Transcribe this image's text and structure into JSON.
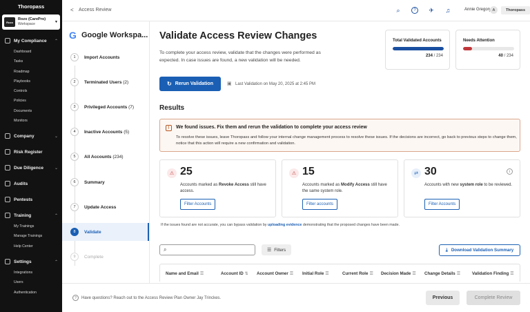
{
  "brand": "Thoropass",
  "workspace": {
    "logo": "Rozo",
    "name": "Rozo (CarePro)",
    "sub": "Workspace"
  },
  "nav": {
    "my_compliance": "My Compliance",
    "compliance_items": [
      "Dashboard",
      "Tasks",
      "Roadmap",
      "Playbooks",
      "Controls",
      "Policies",
      "Documents",
      "Monitors"
    ],
    "company": "Company",
    "risk_register": "Risk Register",
    "due_diligence": "Due Diligence",
    "audits": "Audits",
    "pentests": "Pentests",
    "training": "Training",
    "training_items": [
      "My Trainings",
      "Manage Trainings",
      "Help Center"
    ],
    "settings": "Settings",
    "settings_items": [
      "Integrations",
      "Users",
      "Authentication"
    ]
  },
  "topbar": {
    "back": "<",
    "breadcrumb": "Access Review",
    "user_name": "Annie Gregory",
    "user_initial": "A",
    "org": "Thoropass"
  },
  "steps_panel": {
    "integration": "Google Workspa...",
    "steps": [
      {
        "num": "1",
        "label": "Import Accounts",
        "count": ""
      },
      {
        "num": "2",
        "label": "Terminated Users",
        "count": "(2)"
      },
      {
        "num": "3",
        "label": "Privileged Accounts",
        "count": "(7)"
      },
      {
        "num": "4",
        "label": "Inactive Accounts",
        "count": "(5)"
      },
      {
        "num": "5",
        "label": "All Accounts",
        "count": "(234)"
      },
      {
        "num": "6",
        "label": "Summary",
        "count": ""
      },
      {
        "num": "7",
        "label": "Update Access",
        "count": ""
      },
      {
        "num": "8",
        "label": "Validate",
        "count": ""
      },
      {
        "num": "9",
        "label": "Complete",
        "count": ""
      }
    ]
  },
  "main": {
    "title": "Validate Access Review Changes",
    "intro": "To complete your access review, validate that the changes were performed as expected. In case issues are found, a new validation will be needed.",
    "stats": [
      {
        "title": "Total Validated Accounts",
        "value": "234",
        "total": "/ 234",
        "progress": 1.0,
        "color": "#1a4fa0"
      },
      {
        "title": "Needs Attention",
        "value": "40",
        "total": "/ 234",
        "progress": 0.17,
        "color": "#c0373a"
      }
    ],
    "rerun_label": "Rerun Validation",
    "last_validation": "Last Validation on May 20, 2025 at 2:45 PM",
    "results_heading": "Results",
    "alert": {
      "title": "We found issues. Fix them and rerun the validation to complete your access review",
      "body": "To resolve these issues, leave Thoropass and follow your internal change management process to resolve these issues. If the decisions are incorrect, go back to previous steps to change them, notice that this action will require a new confirmation and validation."
    },
    "cards": [
      {
        "count": "25",
        "pre": "Accounts marked as ",
        "bold": "Revoke Access",
        "post": " still have access.",
        "button": "Filter Accounts"
      },
      {
        "count": "15",
        "pre": "Accounts marked as ",
        "bold": "Modify Access",
        "post": " still have the same system role.",
        "button": "Filter accounts"
      },
      {
        "count": "30",
        "pre": "Accounts with new ",
        "bold": "system role",
        "post": " to be reviewed.",
        "button": "Filter Accounts"
      }
    ],
    "bypass_pre": "If the issues found are not accurate, you can bypass validation by ",
    "bypass_link": "uploading evidence",
    "bypass_post": " demonstrating that the proposed changes have been made.",
    "search_placeholder": "",
    "filters_label": "Filters",
    "download_label": "Download Validation Summary",
    "columns": [
      "Name and Email",
      "Account ID",
      "Account Owner",
      "Initial Role",
      "Current Role",
      "Decision Made",
      "Change Details",
      "Validation Finding"
    ]
  },
  "footer": {
    "help": "Have questions? Reach out to the Access Review Plan Owner Jay Trinckes.",
    "previous": "Previous",
    "complete": "Complete Review"
  }
}
